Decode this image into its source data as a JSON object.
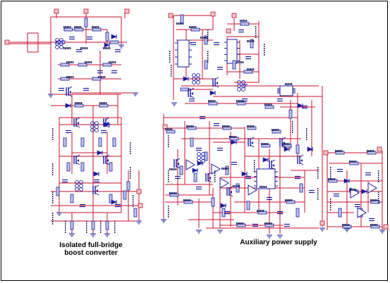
{
  "captions": {
    "left_line1": "Isolated full-bridge",
    "left_line2": "boost converter",
    "right": "Auxiliary power supply"
  },
  "colors": {
    "wire": "#c8102e",
    "component": "#1a1aa0",
    "component_fill": "#c0c8e8",
    "ic_fill": "#ffffff",
    "label": "#202060",
    "frame": "#000000"
  }
}
